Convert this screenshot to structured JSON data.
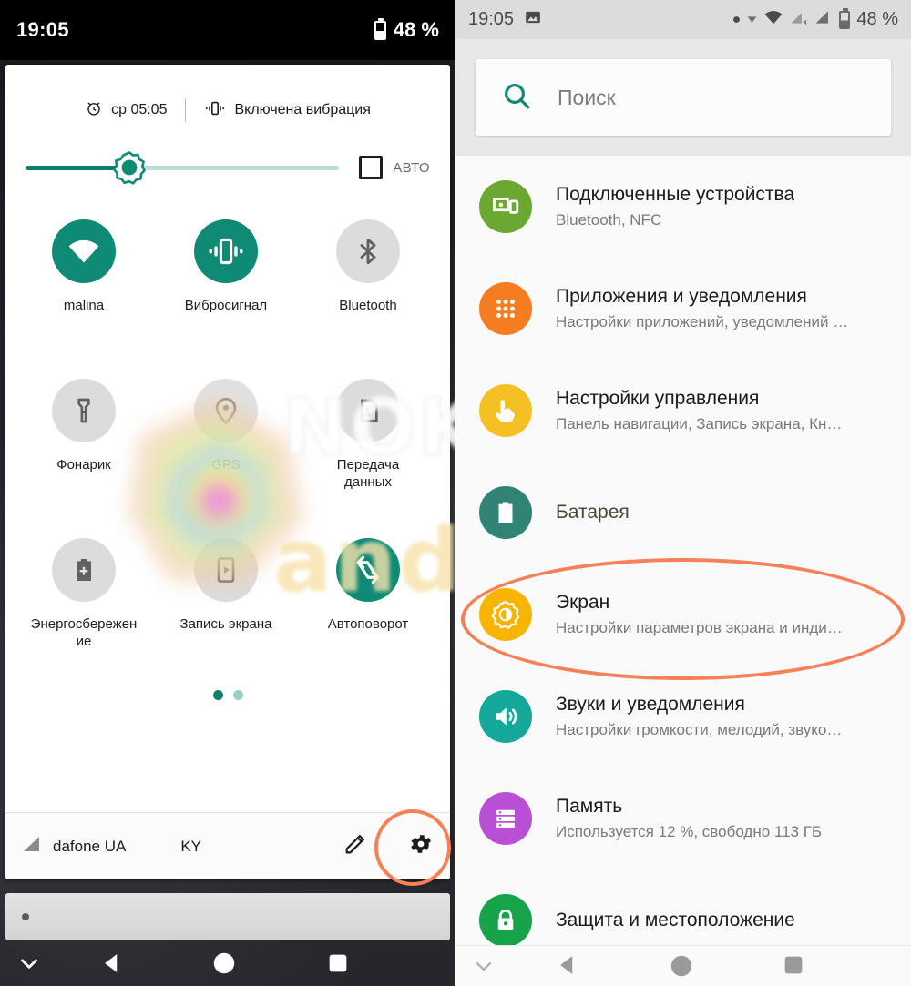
{
  "left_panel": {
    "status_bar": {
      "clock": "19:05",
      "battery_text": "48 %"
    },
    "qs_header": {
      "alarm_text": "ср 05:05",
      "ringer_text": "Включена вибрация"
    },
    "brightness": {
      "auto_label": "АВТО",
      "level_percent": 33
    },
    "tiles": [
      {
        "label": "malina",
        "state": "on",
        "icon": "wifi-icon"
      },
      {
        "label": "Вибросигнал",
        "state": "on",
        "icon": "vibrate-icon"
      },
      {
        "label": "Bluetooth",
        "state": "off",
        "icon": "bluetooth-icon"
      },
      {
        "label": "Фонарик",
        "state": "off",
        "icon": "flashlight-icon"
      },
      {
        "label": "GPS",
        "state": "off",
        "icon": "location-pin-icon"
      },
      {
        "label": "Передача данных",
        "state": "off",
        "icon": "sim-card-1-icon"
      },
      {
        "label": "Энергосбережение",
        "state": "off",
        "icon": "battery-saver-icon"
      },
      {
        "label": "Запись экрана",
        "state": "off",
        "icon": "screen-record-icon"
      },
      {
        "label": "Автоповорот",
        "state": "on",
        "icon": "auto-rotate-icon"
      }
    ],
    "pager": {
      "pages": 2,
      "active": 1
    },
    "footer": {
      "carrier_primary": "dafone UA",
      "carrier_secondary": "KY"
    },
    "nav_bar": [
      "chevron-down-icon",
      "back-icon",
      "home-icon",
      "recents-icon"
    ]
  },
  "right_panel": {
    "status_bar": {
      "clock": "19:05",
      "battery_text": "48 %"
    },
    "search": {
      "placeholder": "Поиск"
    },
    "settings_items": [
      {
        "title": "Подключенные устройства",
        "subtitle": "Bluetooth, NFC",
        "icon": "devices-icon",
        "color": "#6aa832"
      },
      {
        "title": "Приложения и уведомления",
        "subtitle": "Настройки приложений, уведомлений …",
        "icon": "apps-grid-icon",
        "color": "#f57c20"
      },
      {
        "title": "Настройки управления",
        "subtitle": "Панель навигации, Запись экрана, Кн…",
        "icon": "hand-touch-icon",
        "color": "#f5c023"
      },
      {
        "title": "Батарея",
        "subtitle": "",
        "icon": "battery-icon",
        "color": "#2f8475"
      },
      {
        "title": "Экран",
        "subtitle": "Настройки параметров экрана и инди…",
        "icon": "brightness-icon",
        "color": "#f7b500"
      },
      {
        "title": "Звуки и уведомления",
        "subtitle": "Настройки громкости, мелодий, звуко…",
        "icon": "volume-icon",
        "color": "#14a79a"
      },
      {
        "title": "Память",
        "subtitle": "Используется 12 %, свободно 113 ГБ",
        "icon": "storage-icon",
        "color": "#b84fd4"
      },
      {
        "title": "Защита и местоположение",
        "subtitle": "",
        "icon": "lock-icon",
        "color": "#16a34a"
      }
    ],
    "nav_bar": [
      "chevron-down-icon",
      "back-icon",
      "home-icon",
      "recents-icon"
    ]
  },
  "annotations": {
    "highlight_color": "#f58158",
    "gear_circle": "quick-settings-gear",
    "screen_ellipse": "Экран"
  },
  "watermark": {
    "line1": "NOKIA",
    "line2": "android"
  }
}
